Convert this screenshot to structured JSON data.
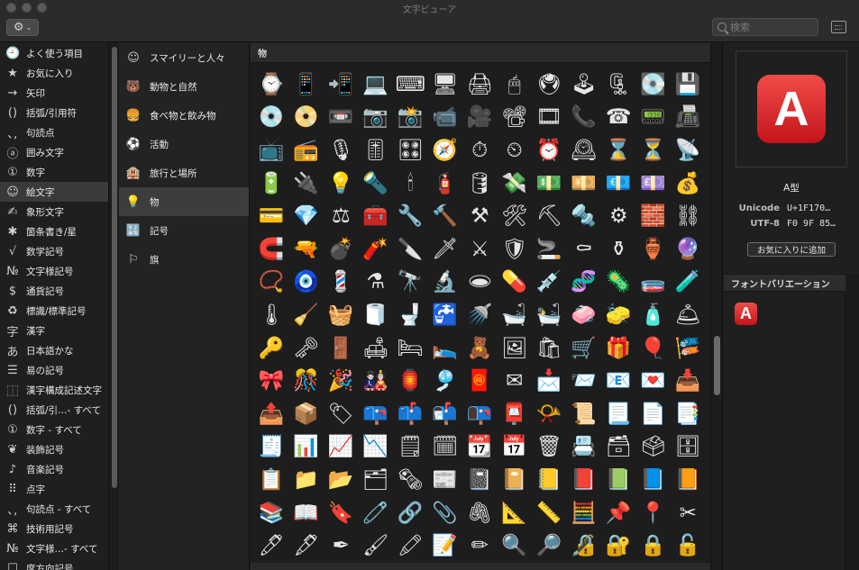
{
  "window": {
    "title": "文字ビューア"
  },
  "toolbar": {
    "gear_glyph": "⚙",
    "chevron": "⌄",
    "search_placeholder": "検索"
  },
  "sidebar": {
    "items": [
      {
        "icon": "🕘",
        "label": "よく使う項目"
      },
      {
        "icon": "★",
        "label": "お気に入り"
      },
      {
        "icon": "→",
        "label": "矢印"
      },
      {
        "icon": "()",
        "label": "括弧/引用符"
      },
      {
        "icon": "､,",
        "label": "句読点"
      },
      {
        "icon": "ⓐ",
        "label": "囲み文字"
      },
      {
        "icon": "①",
        "label": "数字"
      },
      {
        "icon": "☺",
        "label": "絵文字"
      },
      {
        "icon": "✍",
        "label": "象形文字"
      },
      {
        "icon": "✱",
        "label": "箇条書き/星"
      },
      {
        "icon": "√",
        "label": "数学記号"
      },
      {
        "icon": "№",
        "label": "文字様記号"
      },
      {
        "icon": "$",
        "label": "通貨記号"
      },
      {
        "icon": "♻",
        "label": "標識/標準記号"
      },
      {
        "icon": "字",
        "label": "漢字"
      },
      {
        "icon": "あ",
        "label": "日本語かな"
      },
      {
        "icon": "☰",
        "label": "易の記号"
      },
      {
        "icon": "⿰",
        "label": "漢字構成記述文字"
      },
      {
        "icon": "()",
        "label": "括弧/引…- すべて"
      },
      {
        "icon": "①",
        "label": "数字 - すべて"
      },
      {
        "icon": "❦",
        "label": "装飾記号"
      },
      {
        "icon": "♪",
        "label": "音楽記号"
      },
      {
        "icon": "⠿",
        "label": "点字"
      },
      {
        "icon": "､,",
        "label": "句読点 - すべて"
      },
      {
        "icon": "⌘",
        "label": "技術用記号"
      },
      {
        "icon": "№",
        "label": "文字様…- すべて"
      },
      {
        "icon": "☐",
        "label": "度方向記号"
      }
    ],
    "selected_index": 7
  },
  "categories": {
    "items": [
      {
        "icon": "☺",
        "label": "スマイリーと人々"
      },
      {
        "icon": "🐻",
        "label": "動物と自然"
      },
      {
        "icon": "🍔",
        "label": "食べ物と飲み物"
      },
      {
        "icon": "⚽",
        "label": "活動"
      },
      {
        "icon": "🏨",
        "label": "旅行と場所"
      },
      {
        "icon": "💡",
        "label": "物"
      },
      {
        "icon": "🔣",
        "label": "記号"
      },
      {
        "icon": "⚐",
        "label": "旗"
      }
    ],
    "selected_index": 5
  },
  "grid": {
    "header": "物",
    "chars": [
      "⌚",
      "📱",
      "📲",
      "💻",
      "⌨",
      "🖥",
      "🖨",
      "🖱",
      "🖲",
      "🕹",
      "🗜",
      "💽",
      "💾",
      "💿",
      "📀",
      "📼",
      "📷",
      "📸",
      "📹",
      "🎥",
      "📽",
      "🎞",
      "📞",
      "☎",
      "📟",
      "📠",
      "📺",
      "📻",
      "🎙",
      "🎚",
      "🎛",
      "🧭",
      "⏱",
      "⏲",
      "⏰",
      "🕰",
      "⌛",
      "⏳",
      "📡",
      "🔋",
      "🔌",
      "💡",
      "🔦",
      "🕯",
      "🧯",
      "🛢",
      "💸",
      "💵",
      "💴",
      "💶",
      "💷",
      "💰",
      "💳",
      "💎",
      "⚖",
      "🧰",
      "🔧",
      "🔨",
      "⚒",
      "🛠",
      "⛏",
      "🔩",
      "⚙",
      "🧱",
      "⛓",
      "🧲",
      "🔫",
      "💣",
      "🧨",
      "🔪",
      "🗡",
      "⚔",
      "🛡",
      "🚬",
      "⚰",
      "⚱",
      "🏺",
      "🔮",
      "📿",
      "🧿",
      "💈",
      "⚗",
      "🔭",
      "🔬",
      "🕳",
      "💊",
      "💉",
      "🧬",
      "🦠",
      "🧫",
      "🧪",
      "🌡",
      "🧹",
      "🧺",
      "🧻",
      "🚽",
      "🚰",
      "🚿",
      "🛁",
      "🛀",
      "🧼",
      "🧽",
      "🧴",
      "🛎",
      "🔑",
      "🗝",
      "🚪",
      "🛋",
      "🛏",
      "🛌",
      "🧸",
      "🖼",
      "🛍",
      "🛒",
      "🎁",
      "🎈",
      "🎏",
      "🎀",
      "🎊",
      "🎉",
      "🎎",
      "🏮",
      "🎐",
      "🧧",
      "✉",
      "📩",
      "📨",
      "📧",
      "💌",
      "📥",
      "📤",
      "📦",
      "🏷",
      "📪",
      "📫",
      "📬",
      "📭",
      "📮",
      "📯",
      "📜",
      "📃",
      "📄",
      "📑",
      "🧾",
      "📊",
      "📈",
      "📉",
      "🗒",
      "🗓",
      "📆",
      "📅",
      "🗑",
      "📇",
      "🗃",
      "🗳",
      "🗄",
      "📋",
      "📁",
      "📂",
      "🗂",
      "🗞",
      "📰",
      "📓",
      "📔",
      "📒",
      "📕",
      "📗",
      "📘",
      "📙",
      "📚",
      "📖",
      "🔖",
      "🧷",
      "🔗",
      "📎",
      "🖇",
      "📐",
      "📏",
      "🧮",
      "📌",
      "📍",
      "✂",
      "🖊",
      "🖋",
      "✒",
      "🖌",
      "🖍",
      "📝",
      "✏",
      "🔍",
      "🔎",
      "🔏",
      "🔐",
      "🔒",
      "🔓"
    ]
  },
  "detail": {
    "glyph": "A",
    "name": "A型",
    "unicode_label": "Unicode",
    "unicode_value": "U+1F170…",
    "utf8_label": "UTF-8",
    "utf8_value": "F0 9F 85…",
    "fav_button": "お気に入りに追加",
    "variations_header": "フォントバリエーション",
    "variation_glyph": "A"
  }
}
